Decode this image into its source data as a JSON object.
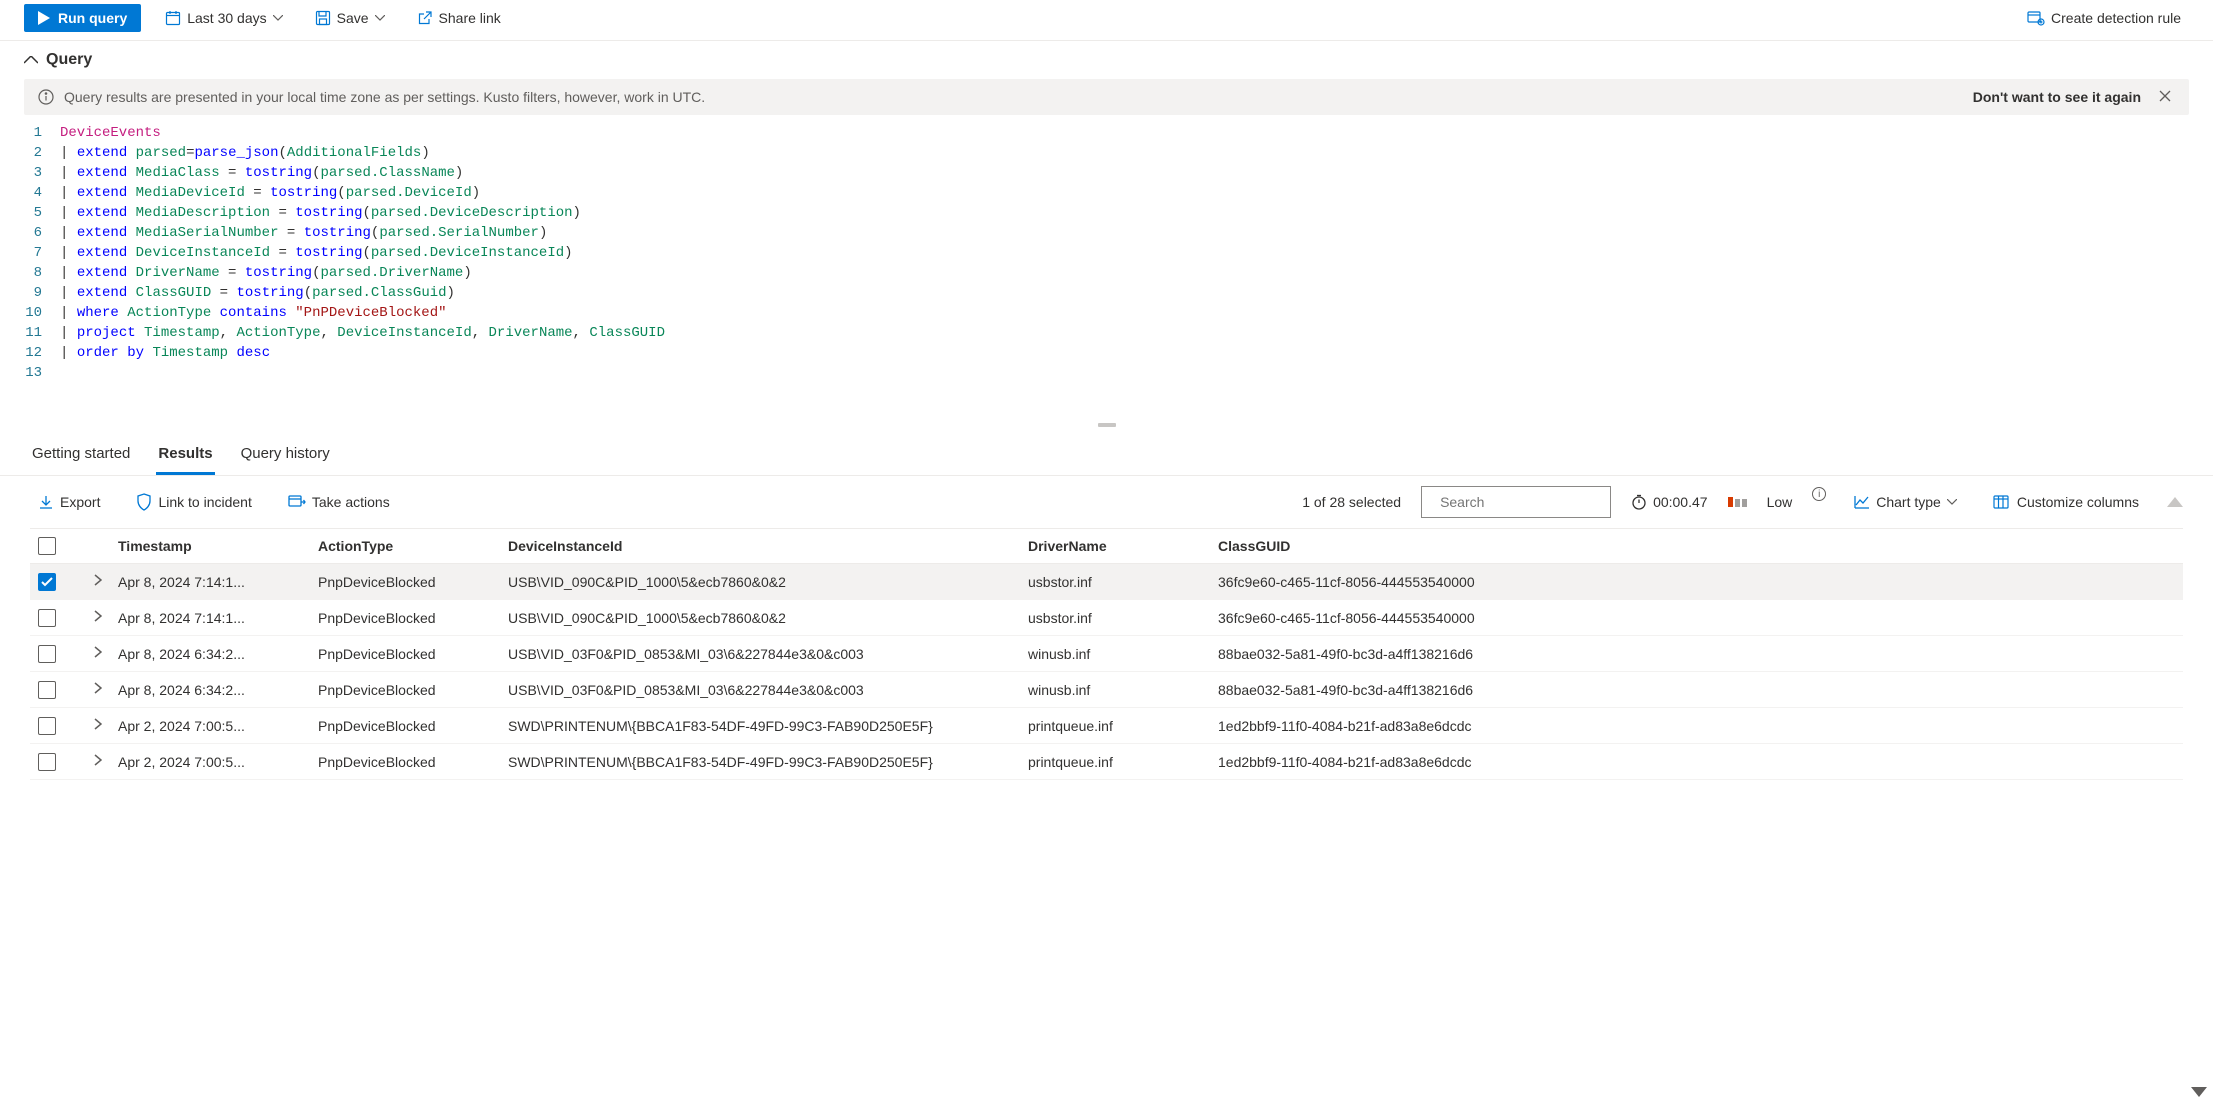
{
  "toolbar": {
    "run": "Run query",
    "timerange": "Last 30 days",
    "save": "Save",
    "share": "Share link",
    "create_rule": "Create detection rule"
  },
  "section": {
    "title": "Query"
  },
  "infobar": {
    "message": "Query results are presented in your local time zone as per settings. Kusto filters, however, work in UTC.",
    "dismiss": "Don't want to see it again"
  },
  "editor_lines": [
    "1",
    "2",
    "3",
    "4",
    "5",
    "6",
    "7",
    "8",
    "9",
    "10",
    "11",
    "12",
    "13"
  ],
  "code": {
    "l1_tbl": "DeviceEvents",
    "l2_kw": "extend",
    "l2_id": "parsed",
    "l2_fn": "parse_json",
    "l2_arg": "AdditionalFields",
    "l3_kw": "extend",
    "l3_id": "MediaClass",
    "l3_fn": "tostring",
    "l3_arg": "parsed.ClassName",
    "l4_kw": "extend",
    "l4_id": "MediaDeviceId",
    "l4_fn": "tostring",
    "l4_arg": "parsed.DeviceId",
    "l5_kw": "extend",
    "l5_id": "MediaDescription",
    "l5_fn": "tostring",
    "l5_arg": "parsed.DeviceDescription",
    "l6_kw": "extend",
    "l6_id": "MediaSerialNumber",
    "l6_fn": "tostring",
    "l6_arg": "parsed.SerialNumber",
    "l7_kw": "extend",
    "l7_id": "DeviceInstanceId",
    "l7_fn": "tostring",
    "l7_arg": "parsed.DeviceInstanceId",
    "l8_kw": "extend",
    "l8_id": "DriverName",
    "l8_fn": "tostring",
    "l8_arg": "parsed.DriverName",
    "l9_kw": "extend",
    "l9_id": "ClassGUID",
    "l9_fn": "tostring",
    "l9_arg": "parsed.ClassGuid",
    "l10_kw": "where",
    "l10_id": "ActionType",
    "l10_op": "contains",
    "l10_str": "\"PnPDeviceBlocked\"",
    "l11_kw": "project",
    "l11_c1": "Timestamp",
    "l11_c2": "ActionType",
    "l11_c3": "DeviceInstanceId",
    "l11_c4": "DriverName",
    "l11_c5": "ClassGUID",
    "l12_kw": "order",
    "l12_by": "by",
    "l12_col": "Timestamp",
    "l12_dir": "desc"
  },
  "tabs": {
    "getting_started": "Getting started",
    "results": "Results",
    "history": "Query history"
  },
  "results_toolbar": {
    "export": "Export",
    "link_incident": "Link to incident",
    "take_actions": "Take actions",
    "selected_count": "1 of 28 selected",
    "search_placeholder": "Search",
    "elapsed": "00:00.47",
    "level": "Low",
    "chart_type": "Chart type",
    "customize": "Customize columns"
  },
  "columns": {
    "timestamp": "Timestamp",
    "action": "ActionType",
    "device": "DeviceInstanceId",
    "driver": "DriverName",
    "guid": "ClassGUID"
  },
  "rows": [
    {
      "checked": true,
      "ts": "Apr 8, 2024 7:14:1...",
      "at": "PnpDeviceBlocked",
      "dev": "USB\\VID_090C&PID_1000\\5&ecb7860&0&2",
      "drv": "usbstor.inf",
      "guid": "36fc9e60-c465-11cf-8056-444553540000"
    },
    {
      "checked": false,
      "ts": "Apr 8, 2024 7:14:1...",
      "at": "PnpDeviceBlocked",
      "dev": "USB\\VID_090C&PID_1000\\5&ecb7860&0&2",
      "drv": "usbstor.inf",
      "guid": "36fc9e60-c465-11cf-8056-444553540000"
    },
    {
      "checked": false,
      "ts": "Apr 8, 2024 6:34:2...",
      "at": "PnpDeviceBlocked",
      "dev": "USB\\VID_03F0&PID_0853&MI_03\\6&227844e3&0&c003",
      "drv": "winusb.inf",
      "guid": "88bae032-5a81-49f0-bc3d-a4ff138216d6"
    },
    {
      "checked": false,
      "ts": "Apr 8, 2024 6:34:2...",
      "at": "PnpDeviceBlocked",
      "dev": "USB\\VID_03F0&PID_0853&MI_03\\6&227844e3&0&c003",
      "drv": "winusb.inf",
      "guid": "88bae032-5a81-49f0-bc3d-a4ff138216d6"
    },
    {
      "checked": false,
      "ts": "Apr 2, 2024 7:00:5...",
      "at": "PnpDeviceBlocked",
      "dev": "SWD\\PRINTENUM\\{BBCA1F83-54DF-49FD-99C3-FAB90D250E5F}",
      "drv": "printqueue.inf",
      "guid": "1ed2bbf9-11f0-4084-b21f-ad83a8e6dcdc"
    },
    {
      "checked": false,
      "ts": "Apr 2, 2024 7:00:5...",
      "at": "PnpDeviceBlocked",
      "dev": "SWD\\PRINTENUM\\{BBCA1F83-54DF-49FD-99C3-FAB90D250E5F}",
      "drv": "printqueue.inf",
      "guid": "1ed2bbf9-11f0-4084-b21f-ad83a8e6dcdc"
    }
  ]
}
